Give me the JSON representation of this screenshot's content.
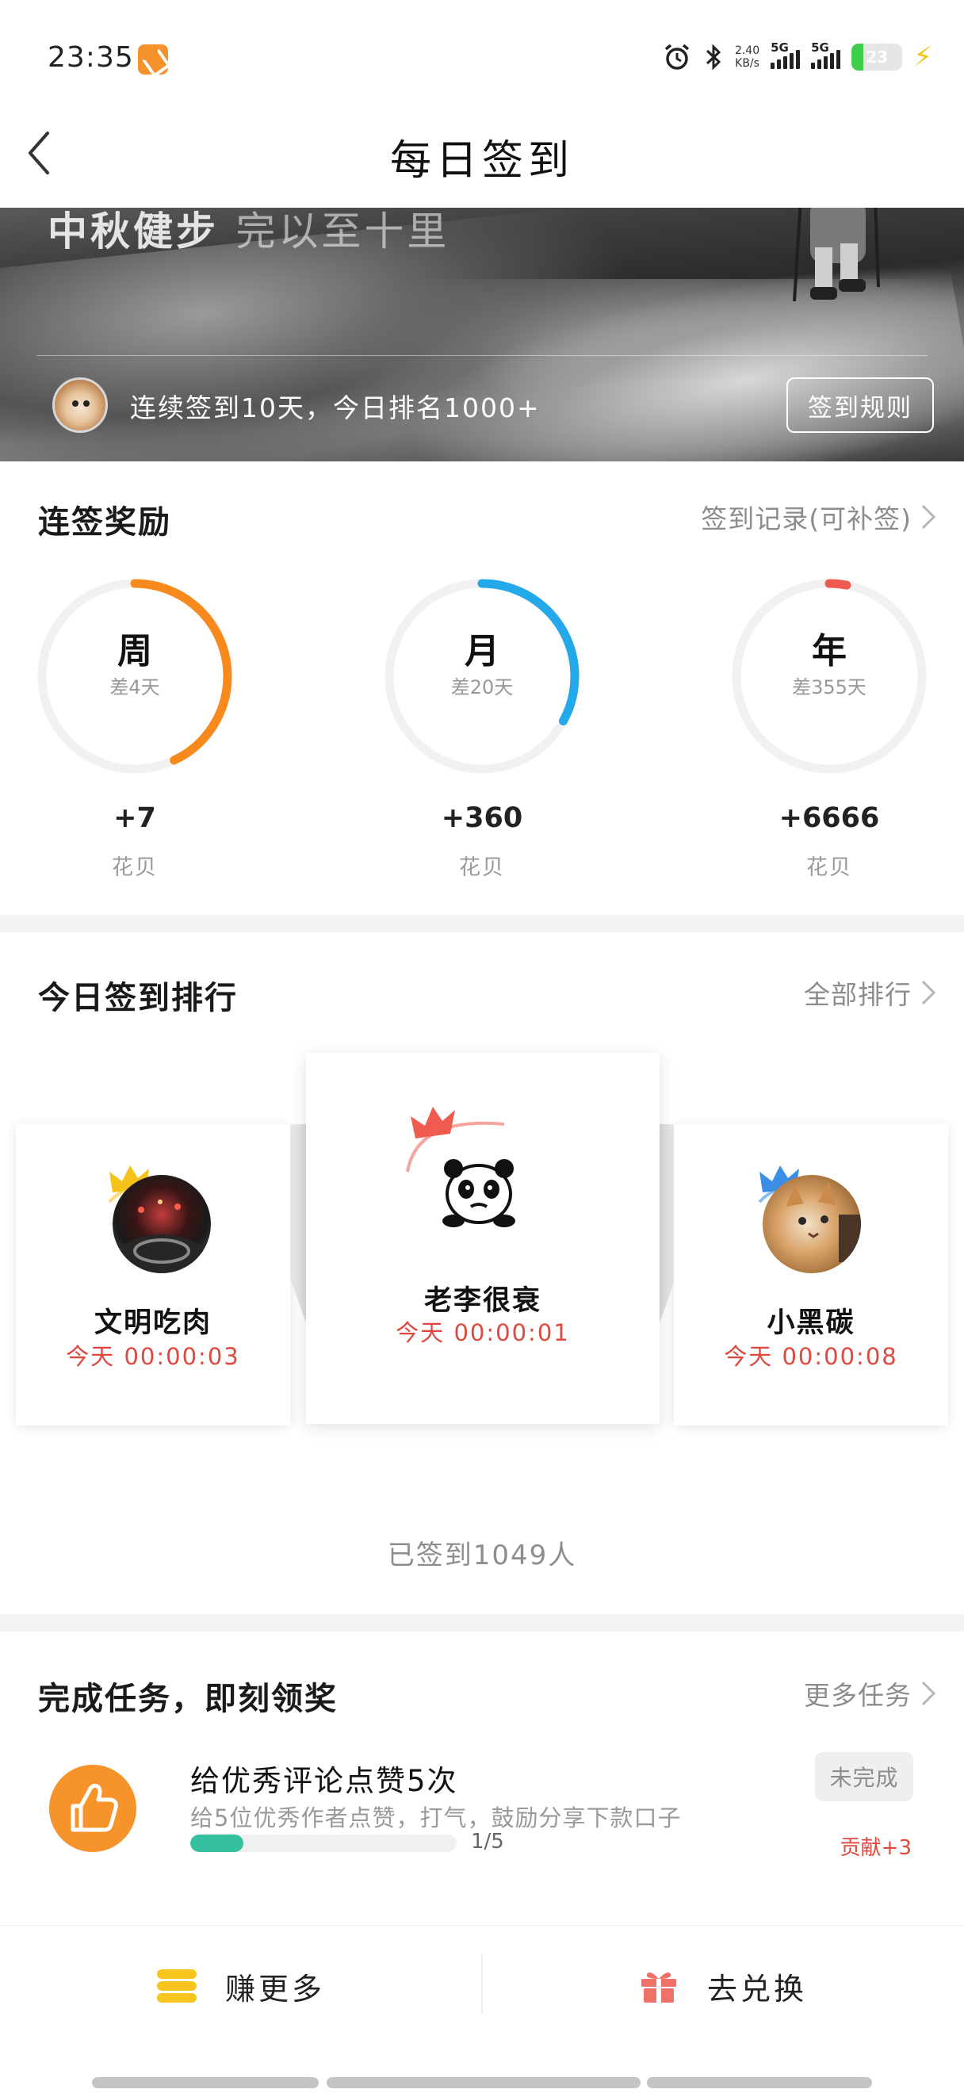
{
  "status_bar": {
    "time": "23:35",
    "net_speed_value": "2.40",
    "net_speed_unit": "KB/s",
    "sim1_label": "5G",
    "sim2_label": "5G",
    "battery": "23",
    "icons": [
      "app-notification-icon",
      "alarm-icon",
      "bluetooth-icon",
      "signal-icon",
      "battery-icon",
      "charging-icon"
    ]
  },
  "header": {
    "title": "每日签到",
    "back_icon": "back-chevron-icon"
  },
  "banner": {
    "partial_text_bold": "中秋健步",
    "partial_text_light": "完以至十里",
    "streak_text": "连续签到10天，今日排名1000+",
    "rules_button": "签到规则"
  },
  "rewards": {
    "title": "连签奖励",
    "record_link": "签到记录(可补签)",
    "items": [
      {
        "label": "周",
        "remaining": "差4天",
        "amount": "+7",
        "unit": "花贝",
        "progress": 0.43,
        "color": "#f7891d"
      },
      {
        "label": "月",
        "remaining": "差20天",
        "amount": "+360",
        "unit": "花贝",
        "progress": 0.33,
        "color": "#23a8ea"
      },
      {
        "label": "年",
        "remaining": "差355天",
        "amount": "+6666",
        "unit": "花贝",
        "progress": 0.03,
        "color": "#ef5b4e"
      }
    ]
  },
  "ranking": {
    "title": "今日签到排行",
    "all_link": "全部排行",
    "entries": [
      {
        "rank": 1,
        "name": "老李很衰",
        "time": "今天 00:00:01",
        "crown_color": "#ef5b4e"
      },
      {
        "rank": 2,
        "name": "文明吃肉",
        "time": "今天 00:00:03",
        "crown_color": "#f5c21a"
      },
      {
        "rank": 3,
        "name": "小黑碳",
        "time": "今天 00:00:08",
        "crown_color": "#3a8ee6"
      }
    ],
    "signed_count": "已签到1049人"
  },
  "tasks": {
    "title": "完成任务，即刻领奖",
    "more_link": "更多任务",
    "items": [
      {
        "title": "给优秀评论点赞5次",
        "description": "给5位优秀作者点赞，打气，鼓励分享下款口子",
        "progress_text": "1/5",
        "progress": 0.2,
        "status": "未完成",
        "reward": "贡献+3"
      }
    ]
  },
  "bottom_bar": {
    "earn_label": "赚更多",
    "exchange_label": "去兑换"
  }
}
